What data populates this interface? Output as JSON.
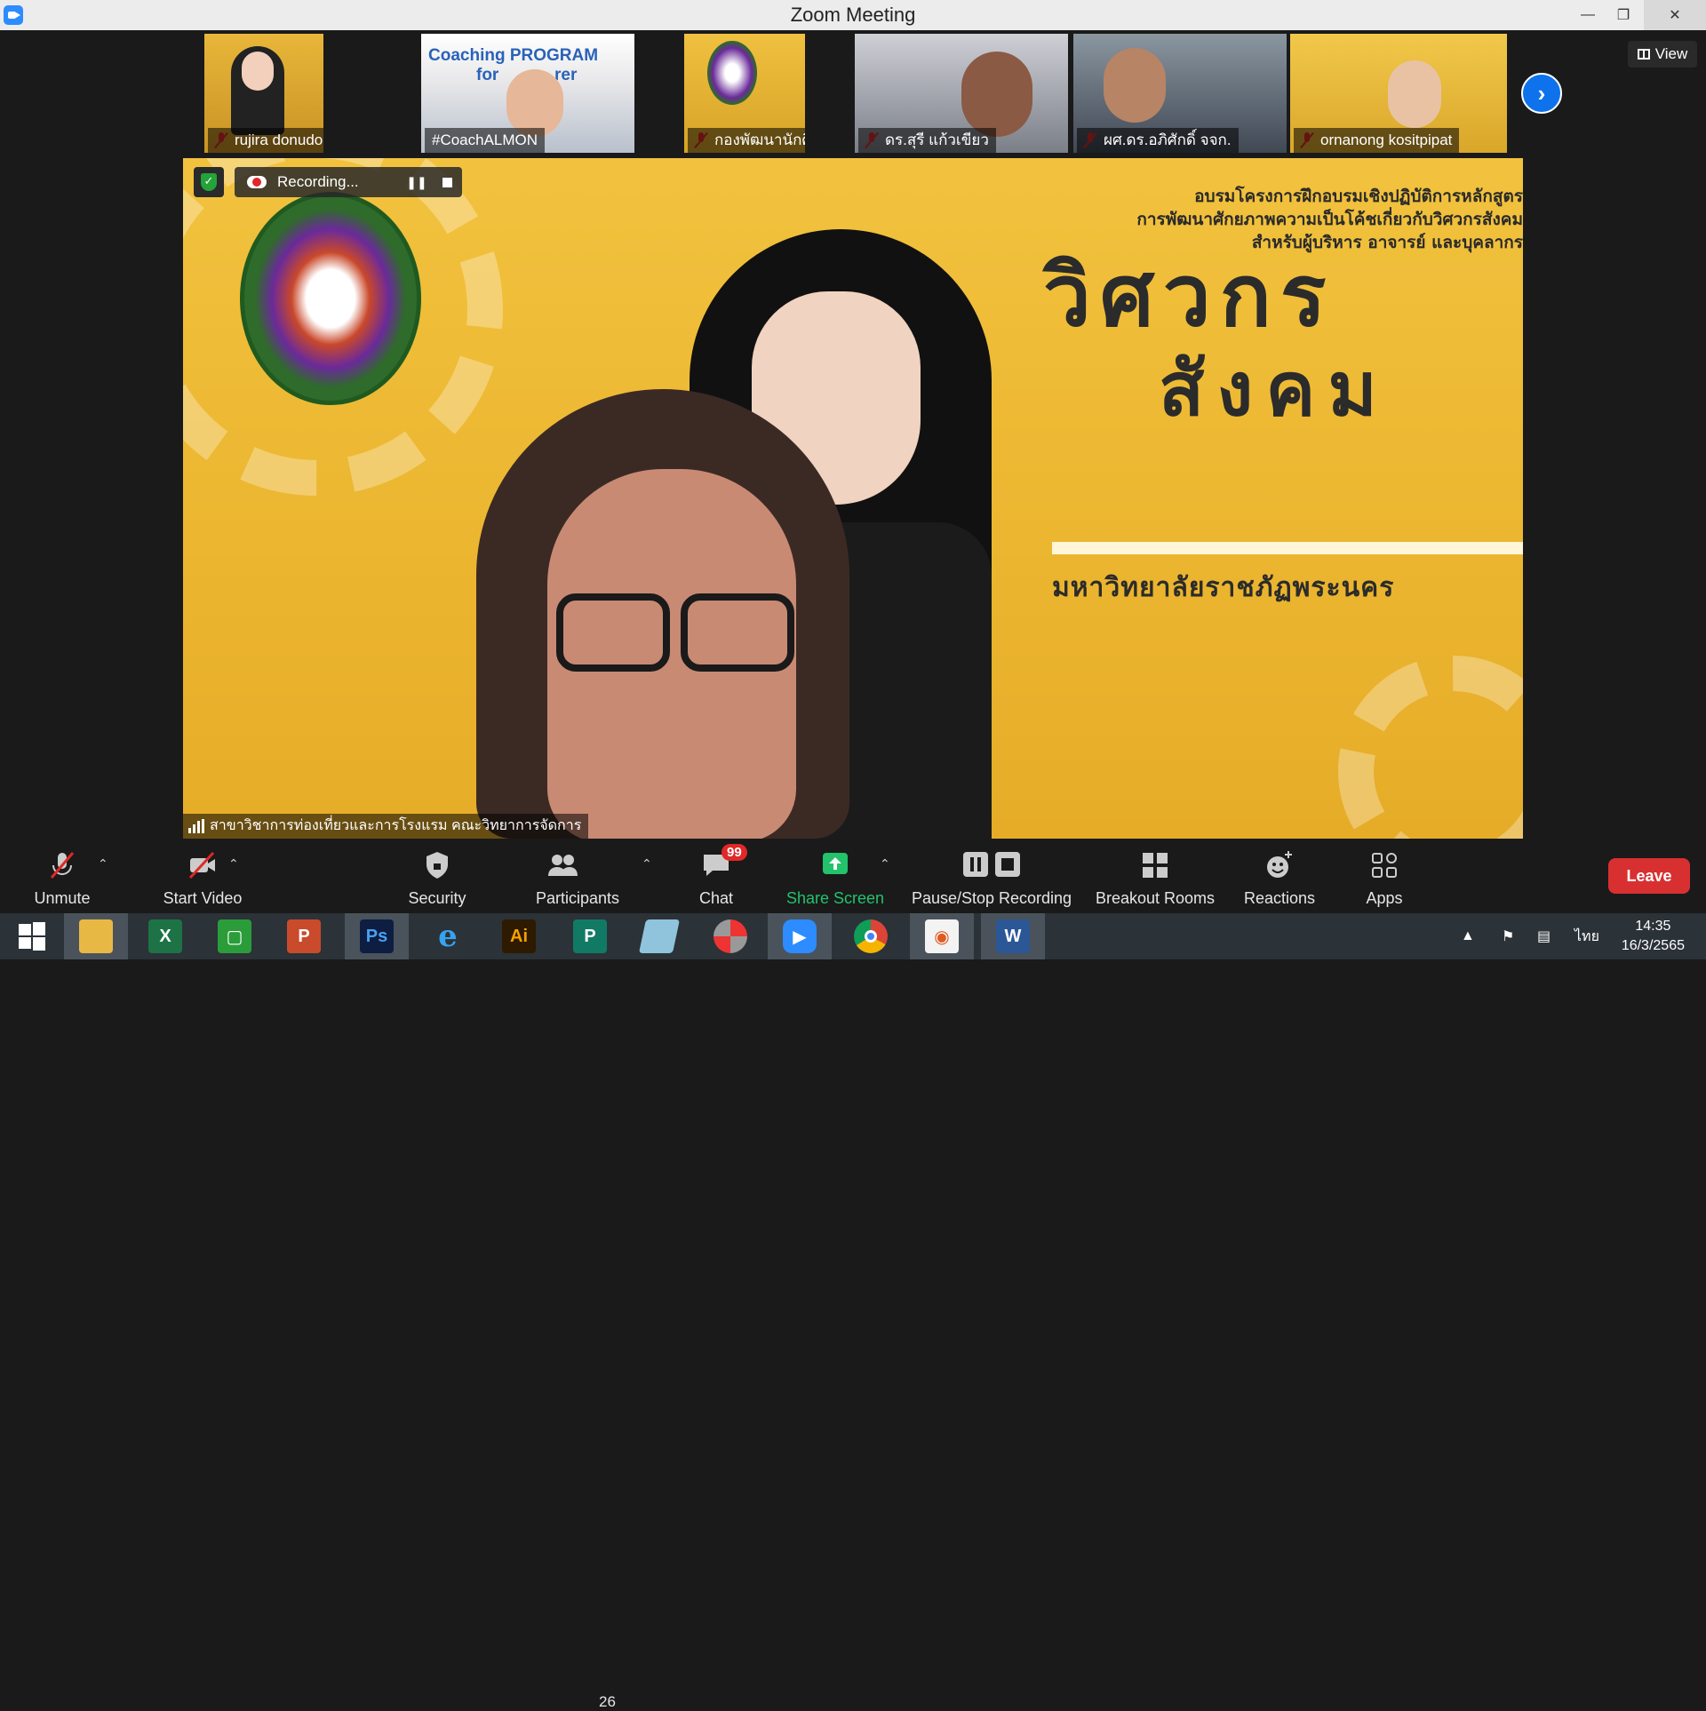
{
  "window": {
    "title": "Zoom Meeting"
  },
  "thumbnails": [
    {
      "name": "rujira donudom",
      "muted": true
    },
    {
      "name": "#CoachALMON",
      "muted": false,
      "banner": "Coaching PROGRAM",
      "banner2": "for",
      "banner3": "rer"
    },
    {
      "name": "กองพัฒนานักศึกษา มรภ.พร...",
      "muted": true
    },
    {
      "name": "ดร.สุรี  แก้วเขียว",
      "muted": true
    },
    {
      "name": "ผศ.ดร.อภิศักดิ์ จจก.",
      "muted": true
    },
    {
      "name": "ornanong kositpipat",
      "muted": true
    }
  ],
  "view_button": {
    "label": "View"
  },
  "recording": {
    "label": "Recording..."
  },
  "main_video": {
    "banner_line1": "อบรมโครงการฝึกอบรมเชิงปฏิบัติการหลักสูตร",
    "banner_line2": "การพัฒนาศักยภาพความเป็นโค้ชเกี่ยวกับวิศวกรสังคม",
    "banner_line3": "สำหรับผู้บริหาร อาจารย์ และบุคลากร",
    "title_word1": "วิศวกร",
    "title_word2": "สังคม",
    "university": "มหาวิทยาลัยราชภัฏพระนคร",
    "speaker_caption": "สาขาวิชาการท่องเที่ยวและการโรงแรม คณะวิทยาการจัดการ"
  },
  "toolbar": {
    "unmute": "Unmute",
    "start_video": "Start Video",
    "security": "Security",
    "participants": "Participants",
    "participants_count": "26",
    "chat": "Chat",
    "chat_badge": "99",
    "share_screen": "Share Screen",
    "pause_stop_recording": "Pause/Stop Recording",
    "breakout_rooms": "Breakout Rooms",
    "reactions": "Reactions",
    "apps": "Apps",
    "leave": "Leave"
  },
  "taskbar": {
    "apps": [
      "start",
      "file-explorer",
      "excel",
      "store",
      "powerpoint",
      "photoshop",
      "internet-explorer",
      "illustrator",
      "publisher",
      "notepad",
      "photoscape",
      "zoom",
      "chrome",
      "slides",
      "word"
    ],
    "language": "ไทย",
    "time": "14:35",
    "date": "16/3/2565"
  },
  "colors": {
    "accent": "#0e72ed",
    "leave": "#d83030",
    "share": "#23c26b",
    "badge": "#e02828"
  }
}
